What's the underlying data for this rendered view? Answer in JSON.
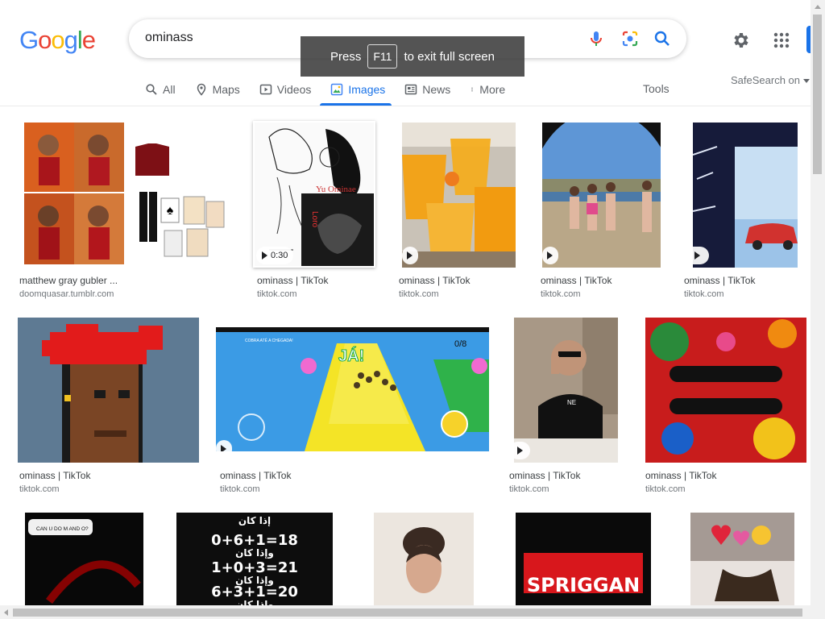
{
  "logo": {
    "letters": [
      "G",
      "o",
      "o",
      "g",
      "l",
      "e"
    ],
    "colors": [
      "#4285f4",
      "#ea4335",
      "#fbbc05",
      "#4285f4",
      "#34a853",
      "#ea4335"
    ]
  },
  "search": {
    "query": "ominass"
  },
  "toast": {
    "press": "Press",
    "key": "F11",
    "rest": "to exit full screen"
  },
  "tabs": [
    {
      "label": "All",
      "icon": "search-icon"
    },
    {
      "label": "Maps",
      "icon": "map-pin-icon"
    },
    {
      "label": "Videos",
      "icon": "play-box-icon"
    },
    {
      "label": "Images",
      "icon": "image-icon"
    },
    {
      "label": "News",
      "icon": "news-icon"
    },
    {
      "label": "More",
      "icon": "more-vert-icon"
    }
  ],
  "tools": "Tools",
  "safesearch": "SafeSearch on",
  "results": [
    {
      "title": "matthew gray gubler ...",
      "source": "doomquasar.tumblr.com",
      "duration": ""
    },
    {
      "title": "ominass | TikTok",
      "source": "tiktok.com",
      "duration": "0:30"
    },
    {
      "title": "ominass | TikTok",
      "source": "tiktok.com",
      "duration": ""
    },
    {
      "title": "ominass | TikTok",
      "source": "tiktok.com",
      "duration": ""
    },
    {
      "title": "ominass | TikTok",
      "source": "tiktok.com",
      "duration": ""
    },
    {
      "title": "ominass | TikTok",
      "source": "tiktok.com",
      "duration": ""
    },
    {
      "title": "ominass | TikTok",
      "source": "tiktok.com",
      "duration": ""
    },
    {
      "title": "ominass | TikTok",
      "source": "tiktok.com",
      "duration": ""
    },
    {
      "title": "ominass | TikTok",
      "source": "tiktok.com",
      "duration": ""
    }
  ],
  "image_text": {
    "sketch_name": "Yu Ominae",
    "sketch_sub": "Loro",
    "game_label": "JÁ!",
    "game_counter": "0/8",
    "game_top": "COBRA ATÉ A CHEGADA!",
    "shirt": "NE",
    "tiktok_caption": "CAN U DO M AND O?",
    "arabic_lines": [
      "إذا كان",
      "0+6+1=18",
      "وإذا كان",
      "1+0+3=21",
      "وإذا كان",
      "6+3+1=20",
      "وإذا كان"
    ],
    "spriggan": "SPRIGGAN"
  }
}
